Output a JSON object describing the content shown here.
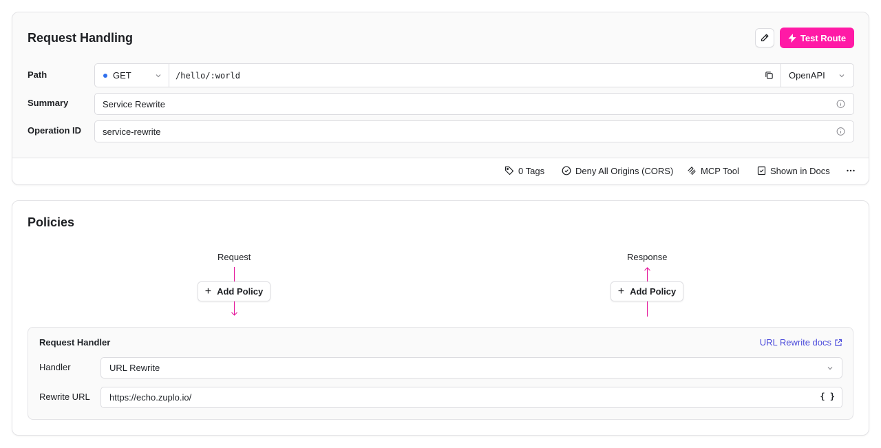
{
  "request_handling": {
    "title": "Request Handling",
    "test_route_label": "Test Route",
    "path_label": "Path",
    "method": "GET",
    "path": "/hello/:world",
    "spec_select": "OpenAPI",
    "summary_label": "Summary",
    "summary_value": "Service Rewrite",
    "operation_id_label": "Operation ID",
    "operation_id_value": "service-rewrite",
    "meta": {
      "tags": "0 Tags",
      "cors": "Deny All Origins (CORS)",
      "mcp": "MCP Tool",
      "docs": "Shown in Docs"
    }
  },
  "policies": {
    "title": "Policies",
    "request_label": "Request",
    "response_label": "Response",
    "add_policy_label": "Add Policy"
  },
  "request_handler": {
    "title": "Request Handler",
    "docs_link": "URL Rewrite docs",
    "handler_label": "Handler",
    "handler_value": "URL Rewrite",
    "rewrite_label": "Rewrite URL",
    "rewrite_value": "https://echo.zuplo.io/",
    "braces": "{ }"
  },
  "colors": {
    "accent": "#ff1aa6",
    "flow_line": "#e5179b",
    "method_dot": "#2f6fed",
    "link": "#4a4adb"
  }
}
